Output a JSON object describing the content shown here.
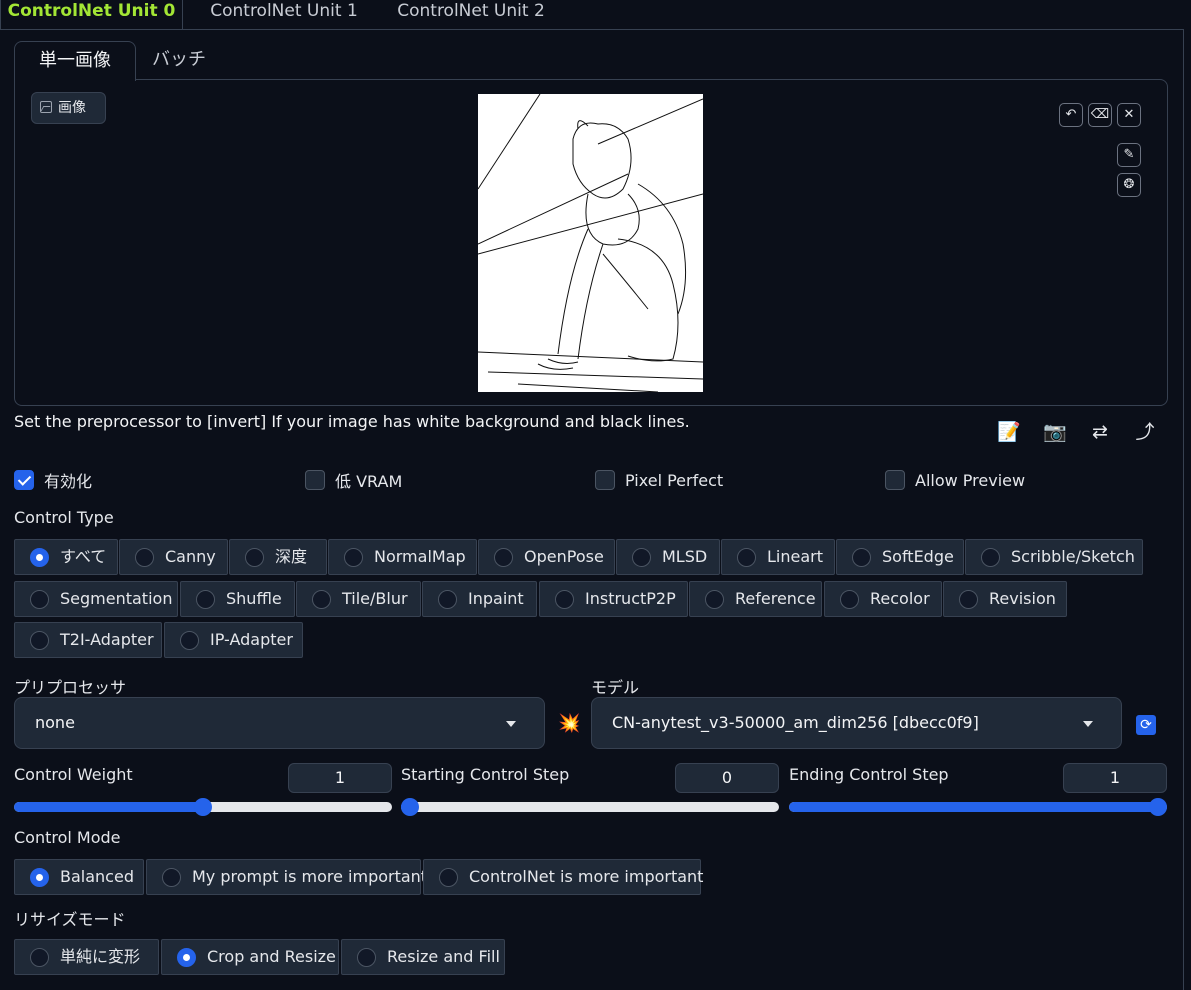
{
  "outer_tabs": [
    "ControlNet Unit 0",
    "ControlNet Unit 1",
    "ControlNet Unit 2"
  ],
  "inner_tabs": [
    "単一画像",
    "バッチ"
  ],
  "image_label": "画像",
  "image_buttons": {
    "undo": "↶",
    "eraser": "⌫",
    "close": "✕",
    "brush": "✎",
    "palette": "❂"
  },
  "hint": "Set the preprocessor to [invert] If your image has white background and black lines.",
  "tools": {
    "notes": "📝",
    "camera": "📷",
    "swap": "⇄",
    "send": "⤴"
  },
  "options": [
    {
      "label": "有効化",
      "checked": true
    },
    {
      "label": "低 VRAM",
      "checked": false
    },
    {
      "label": "Pixel Perfect",
      "checked": false
    },
    {
      "label": "Allow Preview",
      "checked": false
    }
  ],
  "control_type": {
    "label": "Control Type",
    "items": [
      "すべて",
      "Canny",
      "深度",
      "NormalMap",
      "OpenPose",
      "MLSD",
      "Lineart",
      "SoftEdge",
      "Scribble/Sketch",
      "Segmentation",
      "Shuffle",
      "Tile/Blur",
      "Inpaint",
      "InstructP2P",
      "Reference",
      "Recolor",
      "Revision",
      "T2I-Adapter",
      "IP-Adapter"
    ],
    "selected": "すべて"
  },
  "preprocessor": {
    "label": "プリプロセッサ",
    "value": "none",
    "action_icon": "💥"
  },
  "model": {
    "label": "モデル",
    "value": "CN-anytest_v3-50000_am_dim256 [dbecc0f9]",
    "refresh_icon": "⟳"
  },
  "sliders": [
    {
      "label": "Control Weight",
      "value": "1",
      "fraction": 0.5
    },
    {
      "label": "Starting Control Step",
      "value": "0",
      "fraction": 0.0
    },
    {
      "label": "Ending Control Step",
      "value": "1",
      "fraction": 1.0
    }
  ],
  "control_mode": {
    "label": "Control Mode",
    "items": [
      "Balanced",
      "My prompt is more important",
      "ControlNet is more important"
    ],
    "selected": "Balanced"
  },
  "resize_mode": {
    "label": "リサイズモード",
    "items": [
      "単純に変形",
      "Crop and Resize",
      "Resize and Fill"
    ],
    "selected": "Crop and Resize"
  },
  "colors": {
    "accent": "#2563eb",
    "active_tab": "#a3e635",
    "background": "#0b0f19",
    "panel": "#1f2937"
  }
}
